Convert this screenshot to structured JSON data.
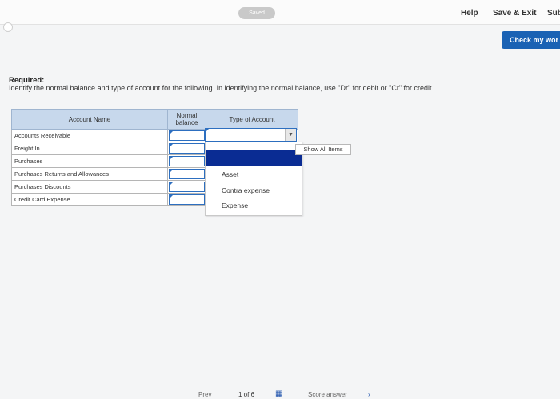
{
  "topbar": {
    "saved_label": "Saved",
    "help_label": "Help",
    "save_exit_label": "Save & Exit",
    "submit_label": "Sub"
  },
  "check_button_label": "Check my wor",
  "required": {
    "title": "Required:",
    "instructions": "Identify the normal balance and type of account for the following. In identifying the normal balance, use \"Dr\" for debit or \"Cr\" for credit."
  },
  "table": {
    "headers": {
      "account_name": "Account Name",
      "normal_balance": "Normal balance",
      "type_of_account": "Type of Account"
    },
    "rows": [
      {
        "account": "Accounts Receivable",
        "normal_balance": "",
        "type": ""
      },
      {
        "account": "Freight In",
        "normal_balance": "",
        "type": ""
      },
      {
        "account": "Purchases",
        "normal_balance": "",
        "type": ""
      },
      {
        "account": "Purchases Returns and Allowances",
        "normal_balance": "",
        "type": ""
      },
      {
        "account": "Purchases Discounts",
        "normal_balance": "",
        "type": ""
      },
      {
        "account": "Credit Card Expense",
        "normal_balance": "",
        "type": ""
      }
    ]
  },
  "dropdown": {
    "show_all_label": "Show All Items",
    "options": [
      "Asset",
      "Contra expense",
      "Expense"
    ]
  },
  "bottom_nav": {
    "prev_label": "Prev",
    "page_label": "1 of 6",
    "score_label": "Score answer"
  },
  "colors": {
    "header_bg": "#c7d8ec",
    "check_button": "#1a62b4",
    "dropdown_highlight": "#0a2c93",
    "input_border": "#2d6fc0"
  }
}
